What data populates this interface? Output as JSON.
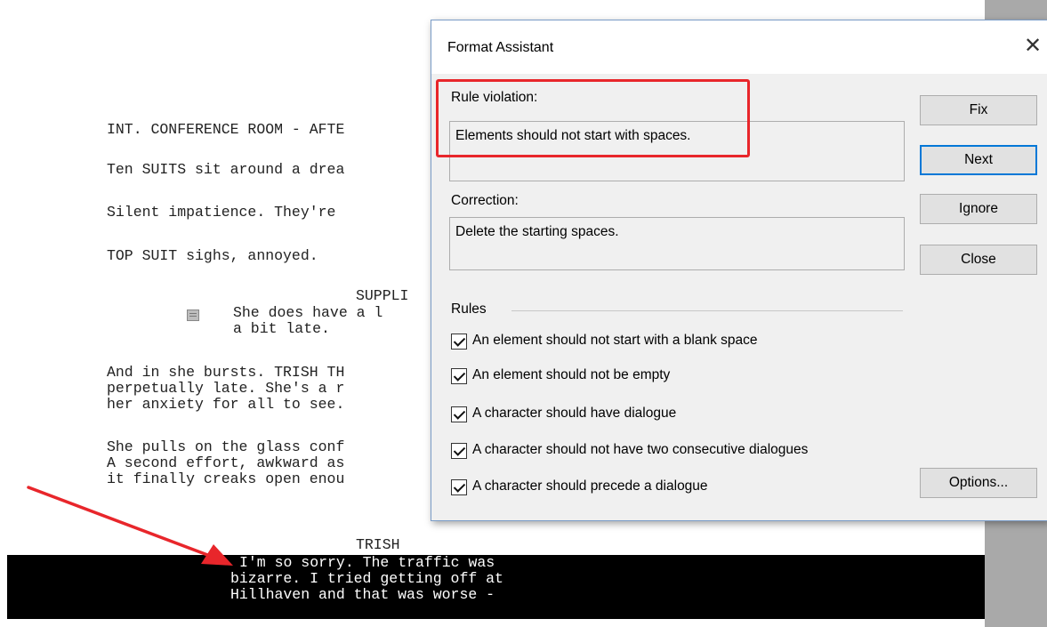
{
  "script": {
    "lines": [
      "INT. CONFERENCE ROOM - AFTE",
      "Ten SUITS sit around a drea",
      "Silent impatience. They're",
      "TOP SUIT sighs, annoyed.",
      "SUPPLI",
      "She does have a l",
      "a bit late.",
      "And in she bursts. TRISH TH",
      "perpetually late. She's a r",
      "her anxiety for all to see.",
      "She pulls on the glass conf",
      "A second effort, awkward as",
      "it finally creaks open enou",
      "TRISH",
      "I'm so sorry. The traffic was",
      "bizarre. I tried getting off at",
      "Hillhaven and that was worse -"
    ]
  },
  "dialog": {
    "title": "Format Assistant",
    "close_label": "✕",
    "rule_violation_label": "Rule violation:",
    "rule_violation_text": "Elements should not start with spaces.",
    "correction_label": "Correction:",
    "correction_text": "Delete the starting spaces.",
    "rules_label": "Rules",
    "rules": [
      {
        "label": "An element should not start with a blank space",
        "checked": true
      },
      {
        "label": "An element should not be empty",
        "checked": true
      },
      {
        "label": "A character should have dialogue",
        "checked": true
      },
      {
        "label": "A character should not have two consecutive dialogues",
        "checked": true
      },
      {
        "label": "A character should precede a dialogue",
        "checked": true
      }
    ],
    "buttons": {
      "fix": "Fix",
      "next": "Next",
      "ignore": "Ignore",
      "close": "Close",
      "options": "Options..."
    }
  },
  "colors": {
    "annotation_red": "#e8262b",
    "focus_blue": "#0078d7"
  }
}
